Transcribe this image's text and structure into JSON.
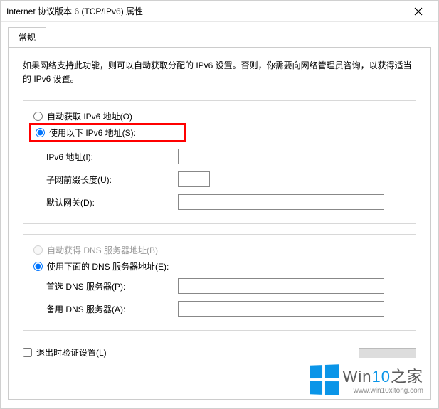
{
  "window": {
    "title": "Internet 协议版本 6 (TCP/IPv6) 属性"
  },
  "tab": {
    "general": "常规"
  },
  "description": "如果网络支持此功能，则可以自动获取分配的 IPv6 设置。否则，你需要向网络管理员咨询，以获得适当的 IPv6 设置。",
  "radios": {
    "auto_addr": "自动获取 IPv6 地址(O)",
    "manual_addr": "使用以下 IPv6 地址(S):",
    "auto_dns": "自动获得 DNS 服务器地址(B)",
    "manual_dns": "使用下面的 DNS 服务器地址(E):"
  },
  "fields": {
    "ipv6_address": {
      "label": "IPv6 地址(I):",
      "value": ""
    },
    "prefix_length": {
      "label": "子网前缀长度(U):",
      "value": ""
    },
    "default_gateway": {
      "label": "默认网关(D):",
      "value": ""
    },
    "preferred_dns": {
      "label": "首选 DNS 服务器(P):",
      "value": ""
    },
    "alternate_dns": {
      "label": "备用 DNS 服务器(A):",
      "value": ""
    }
  },
  "checkbox": {
    "validate_on_exit": "退出时验证设置(L)"
  },
  "watermark": {
    "brand_prefix": "Win",
    "brand_accent": "10",
    "brand_suffix": "之家",
    "url": "www.win10xitong.com"
  }
}
